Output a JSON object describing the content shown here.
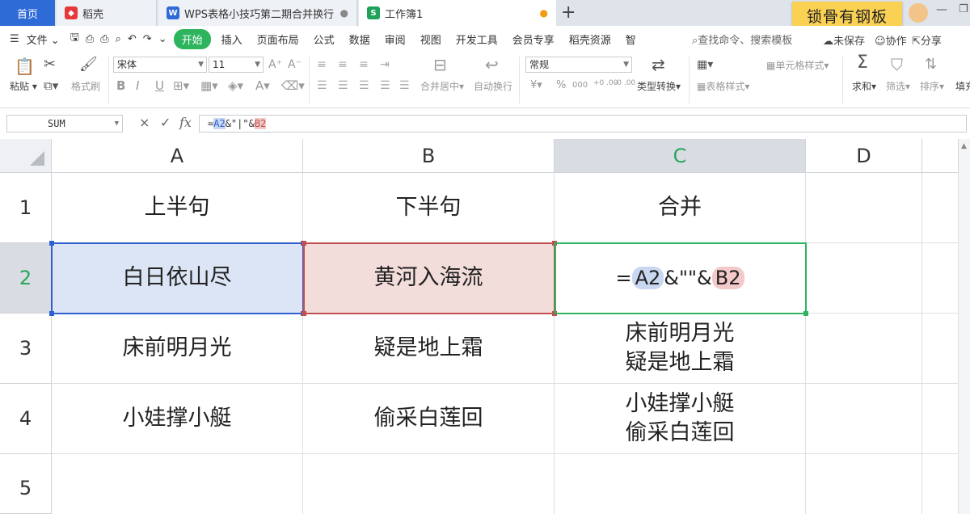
{
  "tabs": {
    "home": "首页",
    "daoke": "稻壳",
    "doc": "WPS表格小技巧第二期合并换行",
    "workbook": "工作簿1",
    "new_tab": "+"
  },
  "banner": "锁骨有钢板",
  "menu": {
    "file": "文件",
    "start": "开始",
    "items": [
      "插入",
      "页面布局",
      "公式",
      "数据",
      "审阅",
      "视图",
      "开发工具",
      "会员专享",
      "稻壳资源",
      "智"
    ],
    "search": "查找命令、搜索模板",
    "unsaved": "未保存",
    "collab": "协作",
    "share": "分享"
  },
  "toolbar": {
    "paste": "粘贴",
    "format_brush": "格式刷",
    "font_name": "宋体",
    "font_size": "11",
    "merge_center": "合并居中",
    "auto_wrap": "自动换行",
    "number_format": "常规",
    "type_convert": "类型转换",
    "cell_style": "单元格样式",
    "table_style": "表格样式",
    "sum": "求和",
    "filter": "筛选",
    "sort": "排序",
    "fill": "填充",
    "currency": "¥",
    "percent": "%",
    "thousands": "000",
    "dec_inc": "+0 .00",
    "dec_dec": "-0 .00"
  },
  "formula_bar": {
    "name_box": "SUM",
    "cancel": "×",
    "confirm": "✓",
    "fx": "fx",
    "eq": "=",
    "ref_a": "A2",
    "mid": "&\"|\"&",
    "ref_b": "B2"
  },
  "columns": [
    "A",
    "B",
    "C",
    "D"
  ],
  "rows": [
    "1",
    "2",
    "3",
    "4",
    "5"
  ],
  "cells": {
    "a1": "上半句",
    "b1": "下半句",
    "c1": "合并",
    "a2": "白日依山尽",
    "b2": "黄河入海流",
    "c2_eq": "=",
    "c2_ref_a": "A2",
    "c2_mid": "&\"\"&",
    "c2_ref_b": "B2",
    "a3": "床前明月光",
    "b3": "疑是地上霜",
    "c3_line1": "床前明月光",
    "c3_line2": "疑是地上霜",
    "a4": "小娃撑小艇",
    "b4": "偷采白莲回",
    "c4_line1": "小娃撑小艇",
    "c4_line2": "偷采白莲回"
  },
  "colors": {
    "accent_green": "#2db45d",
    "ref_a_blue": "#2f5fd0",
    "ref_b_red": "#c0504d"
  }
}
